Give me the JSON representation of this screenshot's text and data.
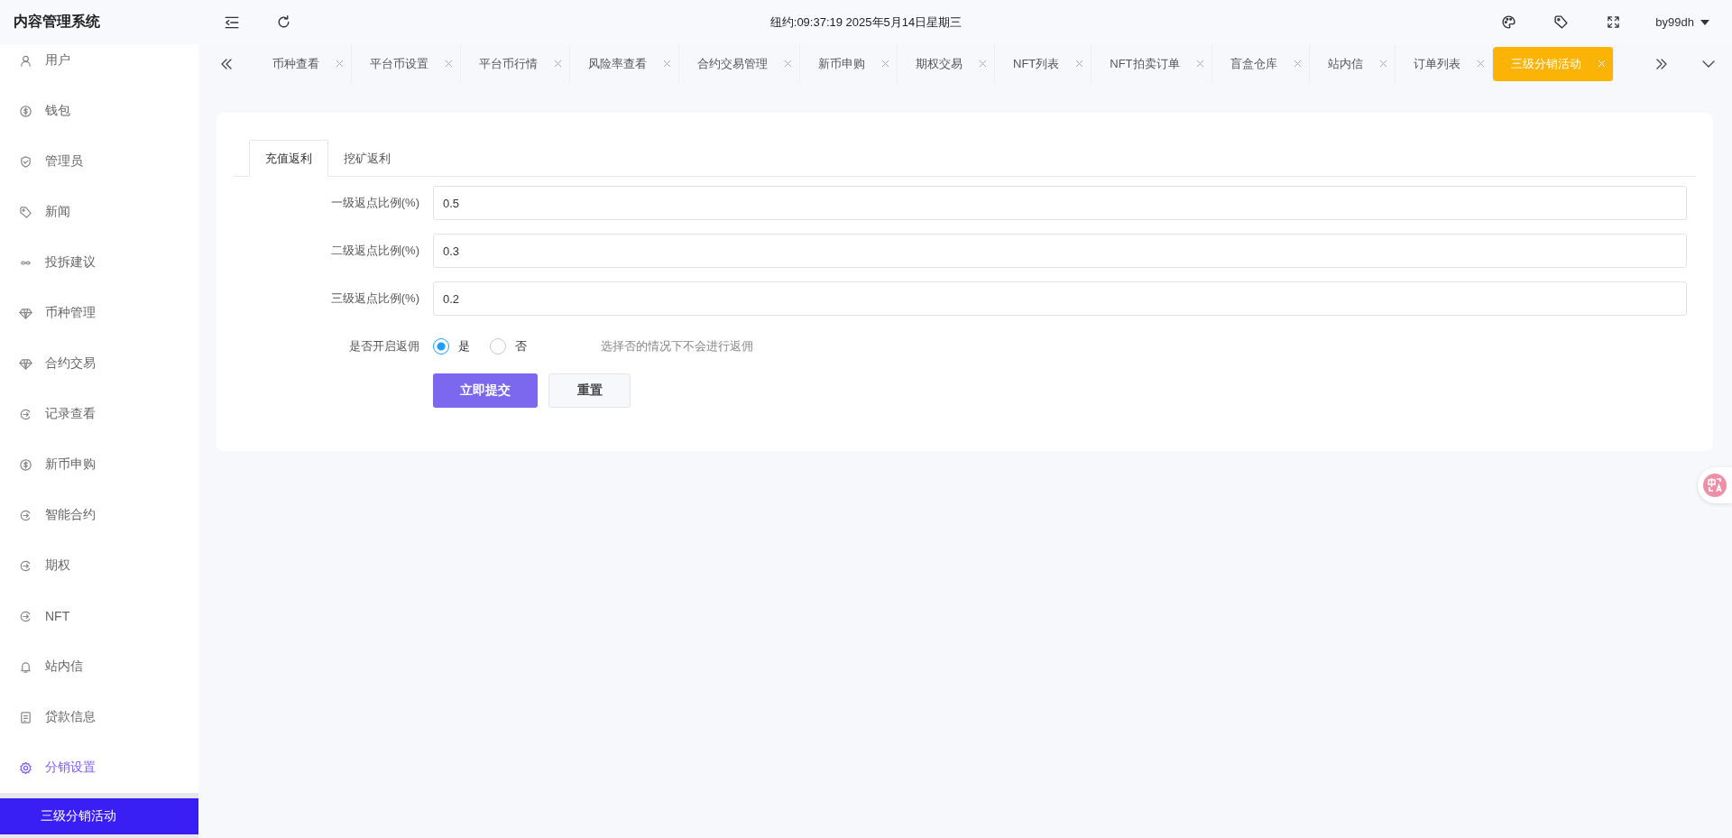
{
  "header": {
    "title": "内容管理系统",
    "clock": "纽约:09:37:19 2025年5月14日星期三",
    "user": "by99dh"
  },
  "sidebar": {
    "items": [
      {
        "label": "用户",
        "kind": "user",
        "selected": false
      },
      {
        "label": "钱包",
        "kind": "coin",
        "selected": false
      },
      {
        "label": "管理员",
        "kind": "shield",
        "selected": false
      },
      {
        "label": "新闻",
        "kind": "tag",
        "selected": false
      },
      {
        "label": "投拆建议",
        "kind": "link",
        "selected": false
      },
      {
        "label": "币种管理",
        "kind": "gem",
        "selected": false
      },
      {
        "label": "合约交易",
        "kind": "gem",
        "selected": false
      },
      {
        "label": "记录查看",
        "kind": "cycle",
        "selected": false
      },
      {
        "label": "新币申购",
        "kind": "coin",
        "selected": false
      },
      {
        "label": "智能合约",
        "kind": "cycle",
        "selected": false
      },
      {
        "label": "期权",
        "kind": "cycle",
        "selected": false
      },
      {
        "label": "NFT",
        "kind": "cycle",
        "selected": false
      },
      {
        "label": "站内信",
        "kind": "bell",
        "selected": false
      },
      {
        "label": "贷款信息",
        "kind": "doc",
        "selected": false
      },
      {
        "label": "分销设置",
        "kind": "gear",
        "selected": true,
        "children": [
          {
            "label": "三级分销活动",
            "selected": true
          }
        ]
      }
    ]
  },
  "tabs": [
    {
      "label": "币种查看",
      "selected": false
    },
    {
      "label": "平台币设置",
      "selected": false
    },
    {
      "label": "平台币行情",
      "selected": false
    },
    {
      "label": "风险率查看",
      "selected": false
    },
    {
      "label": "合约交易管理",
      "selected": false
    },
    {
      "label": "新币申购",
      "selected": false
    },
    {
      "label": "期权交易",
      "selected": false
    },
    {
      "label": "NFT列表",
      "selected": false
    },
    {
      "label": "NFT拍卖订单",
      "selected": false
    },
    {
      "label": "盲盒仓库",
      "selected": false
    },
    {
      "label": "站内信",
      "selected": false
    },
    {
      "label": "订单列表",
      "selected": false
    },
    {
      "label": "三级分销活动",
      "selected": true
    }
  ],
  "form": {
    "tabs": [
      {
        "label": "充值返利",
        "selected": true
      },
      {
        "label": "挖矿返利",
        "selected": false
      }
    ],
    "fields": [
      {
        "label": "一级返点比例(%)",
        "value": "0.5"
      },
      {
        "label": "二级返点比例(%)",
        "value": "0.3"
      },
      {
        "label": "三级返点比例(%)",
        "value": "0.2"
      }
    ],
    "switch": {
      "label": "是否开启返佣",
      "options": [
        {
          "label": "是",
          "selected": true
        },
        {
          "label": "否",
          "selected": false
        }
      ],
      "hint": "选择否的情况下不会进行返佣"
    },
    "buttons": [
      {
        "label": "立即提交",
        "kind": "primary"
      },
      {
        "label": "重置",
        "kind": "default"
      }
    ]
  }
}
